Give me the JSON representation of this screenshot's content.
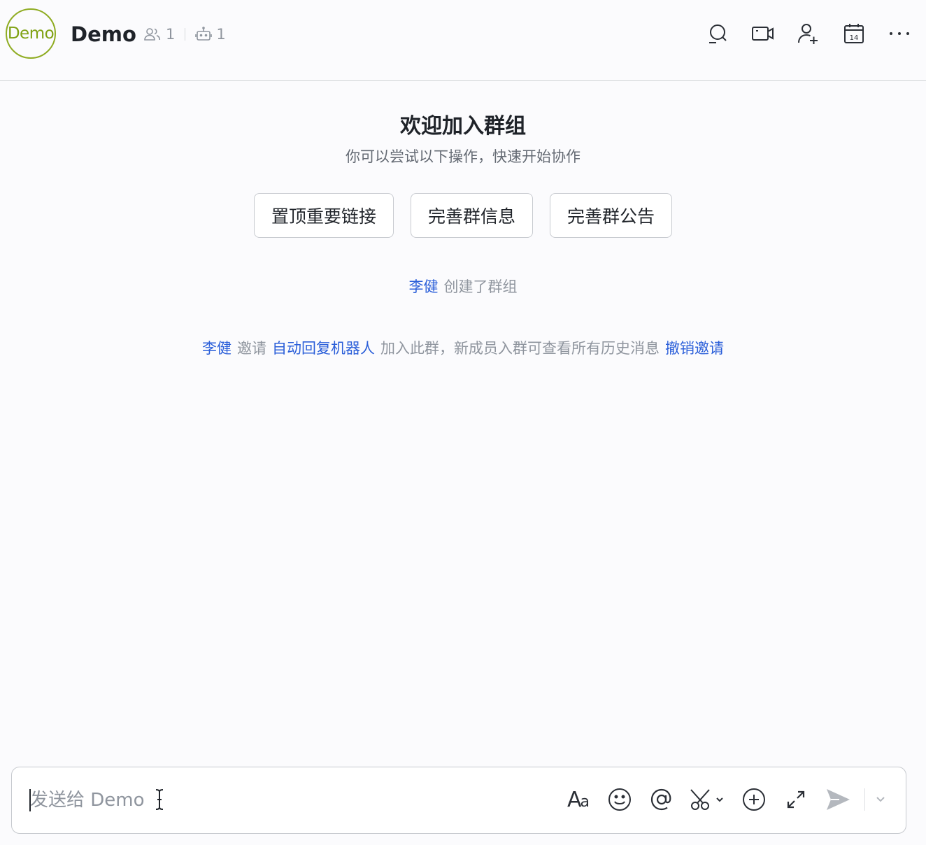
{
  "header": {
    "avatar_text": "Demo",
    "title": "Demo",
    "member_count": "1",
    "bot_count": "1",
    "icons": [
      "search-icon",
      "video-icon",
      "add-member-icon",
      "calendar-icon",
      "more-icon"
    ],
    "calendar_day": "14"
  },
  "welcome": {
    "title": "欢迎加入群组",
    "subtitle": "你可以尝试以下操作，快速开始协作",
    "actions": [
      "置顶重要链接",
      "完善群信息",
      "完善群公告"
    ]
  },
  "events": {
    "created": {
      "user": "李健",
      "text": "创建了群组"
    },
    "invited": {
      "user": "李健",
      "verb": "邀请",
      "target": "自动回复机器人",
      "text": "加入此群，新成员入群可查看所有历史消息",
      "action": "撤销邀请"
    }
  },
  "composer": {
    "placeholder": "发送给 Demo",
    "value": "",
    "format_label_big": "A",
    "format_label_small": "a"
  },
  "colors": {
    "accent": "#2b5fd9",
    "avatar_border": "#8fac22",
    "muted": "#8f959e"
  }
}
